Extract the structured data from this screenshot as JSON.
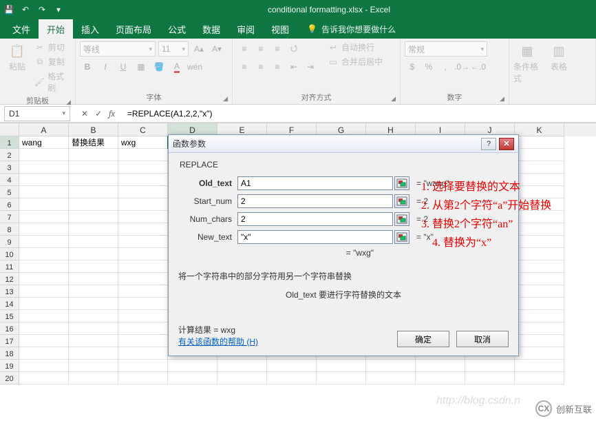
{
  "title": "conditional formatting.xlsx - Excel",
  "qat": {
    "save": "💾",
    "undo": "↶",
    "redo": "↷"
  },
  "tabs": [
    "文件",
    "开始",
    "插入",
    "页面布局",
    "公式",
    "数据",
    "审阅",
    "视图"
  ],
  "active_tab": 1,
  "tell_me": "告诉我你想要做什么",
  "ribbon": {
    "clipboard": {
      "paste": "粘贴",
      "cut": "剪切",
      "copy": "复制",
      "format_painter": "格式刷",
      "label": "剪贴板"
    },
    "font": {
      "name": "等线",
      "size": "11",
      "label": "字体",
      "bold": "B",
      "italic": "I",
      "underline": "U"
    },
    "align": {
      "wrap": "自动换行",
      "merge": "合并后居中",
      "label": "对齐方式"
    },
    "number": {
      "format": "常规",
      "label": "数字"
    },
    "styles": {
      "cond": "条件格式",
      "label": "表格"
    }
  },
  "namebox": "D1",
  "formula": "=REPLACE(A1,2,2,\"x\")",
  "columns": [
    "A",
    "B",
    "C",
    "D",
    "E",
    "F",
    "G",
    "H",
    "I",
    "J",
    "K"
  ],
  "rows": [
    "1",
    "2",
    "3",
    "4",
    "5",
    "6",
    "7",
    "8",
    "9",
    "10",
    "11",
    "12",
    "13",
    "14",
    "15",
    "16",
    "17",
    "18",
    "19",
    "20"
  ],
  "grid": {
    "A1": "wang",
    "B1": "替换结果",
    "C1": "wxg"
  },
  "dialog": {
    "title": "函数参数",
    "fn": "REPLACE",
    "args": [
      {
        "label": "Old_text",
        "value": "A1",
        "eval": "=  \"wang\"",
        "bold": true
      },
      {
        "label": "Start_num",
        "value": "2",
        "eval": "=  2"
      },
      {
        "label": "Num_chars",
        "value": "2",
        "eval": "=  2"
      },
      {
        "label": "New_text",
        "value": "\"x\"",
        "eval": "=  \"x\""
      }
    ],
    "result_eq": "=  \"wxg\"",
    "desc1": "将一个字符串中的部分字符用另一个字符串替换",
    "desc2": "Old_text    要进行字符替换的文本",
    "calc": "计算结果 =   wxg",
    "help": "有关该函数的帮助 (H)",
    "ok": "确定",
    "cancel": "取消"
  },
  "annotations": [
    "1. 选择要替换的文本",
    "2. 从第2个字符“a”开始替换",
    "3. 替换2个字符“an”",
    "4. 替换为“x”"
  ],
  "watermark": {
    "csdn": "http://blog.csdn.n",
    "logo": "创新互联"
  }
}
